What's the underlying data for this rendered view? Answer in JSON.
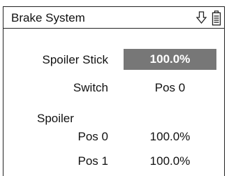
{
  "window": {
    "title": "Brake System",
    "icons": [
      "arrow-down-outline-icon",
      "battery-icon"
    ]
  },
  "rows": {
    "spoiler_stick": {
      "label": "Spoiler Stick",
      "value": "100.0%"
    },
    "switch": {
      "label": "Switch",
      "value": "Pos 0"
    }
  },
  "spoiler": {
    "heading": "Spoiler",
    "positions": [
      {
        "label": "Pos 0",
        "value": "100.0%"
      },
      {
        "label": "Pos 1",
        "value": "100.0%"
      }
    ]
  },
  "colors": {
    "highlight_bg": "#777777",
    "highlight_text": "#ffffff"
  }
}
